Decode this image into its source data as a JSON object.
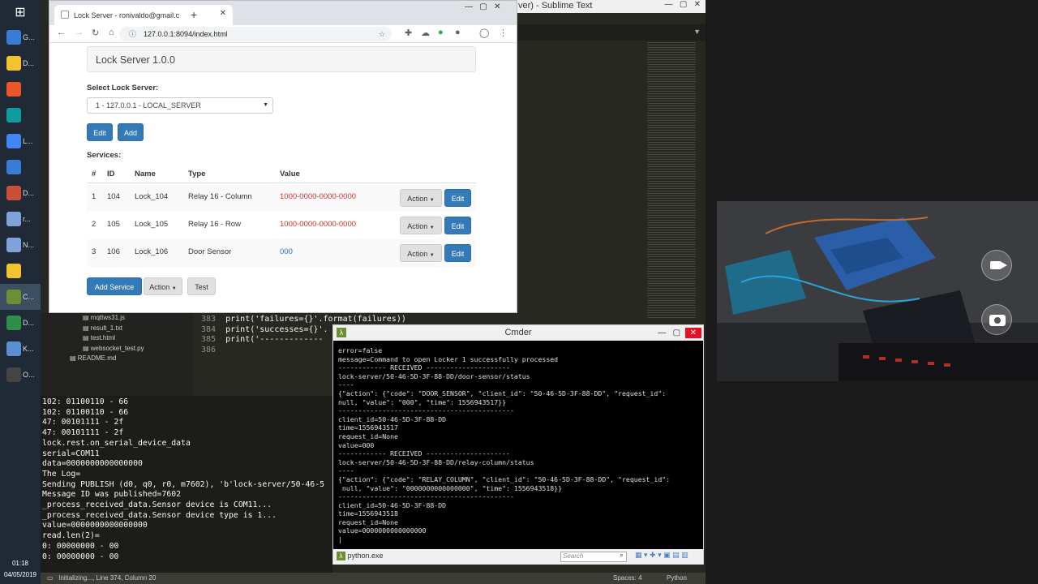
{
  "taskbar": {
    "items": [
      {
        "label": "G..."
      },
      {
        "label": "D..."
      },
      {
        "label": ""
      },
      {
        "label": ""
      },
      {
        "label": "L..."
      },
      {
        "label": ""
      },
      {
        "label": "D..."
      },
      {
        "label": "r..."
      },
      {
        "label": "N..."
      },
      {
        "label": ""
      },
      {
        "label": "C..."
      },
      {
        "label": "D..."
      },
      {
        "label": "K..."
      },
      {
        "label": "O..."
      }
    ],
    "time": "01:18",
    "date": "04/05/2019"
  },
  "sublime": {
    "title": "ver) - Sublime Text",
    "code_lines": [
      {
        "num": "383",
        "text": "print('failures={}'.format(failures))"
      },
      {
        "num": "384",
        "text": "print('successes={}'."
      },
      {
        "num": "385",
        "text": "print('-------------"
      },
      {
        "num": "386",
        "text": ""
      }
    ],
    "sidebar_files": [
      "mqttws31.js",
      "result_1.txt",
      "test.html",
      "websocket_test.py",
      "README.md"
    ],
    "console_lines": [
      "102: 01100110 - 66",
      "102: 01100110 - 66",
      "47: 00101111 - 2f",
      "47: 00101111 - 2f",
      "lock.rest.on_serial_device_data",
      "serial=COM11",
      "data=0000000000000000",
      "The Log=",
      "Sending PUBLISH (d0, q0, r0, m7602), 'b'lock-server/50-46-5",
      "Message ID was published=7602",
      "_process_received_data.Sensor device is COM11...",
      "_process_received_data.Sensor device type is 1...",
      "value=0000000000000000",
      "read.len(2)=",
      "0: 00000000 - 00",
      "0: 00000000 - 00"
    ],
    "status_left": "Initializing..., Line 374, Column 20",
    "status_spaces": "Spaces: 4",
    "status_lang": "Python"
  },
  "browser": {
    "tab_title": "Lock Server - ronivaldo@gmail.c",
    "url": "127.0.0.1:8094/index.html",
    "app_title": "Lock Server 1.0.0",
    "select_label": "Select Lock Server:",
    "select_value": "1 - 127.0.0.1 - LOCAL_SERVER",
    "edit_label": "Edit",
    "add_label": "Add",
    "services_label": "Services:",
    "columns": [
      "#",
      "ID",
      "Name",
      "Type",
      "Value"
    ],
    "rows": [
      {
        "n": "1",
        "id": "104",
        "name": "Lock_104",
        "type": "Relay 16 - Column",
        "value": "1000-0000-0000-0000"
      },
      {
        "n": "2",
        "id": "105",
        "name": "Lock_105",
        "type": "Relay 16 - Row",
        "value": "1000-0000-0000-0000"
      },
      {
        "n": "3",
        "id": "106",
        "name": "Lock_106",
        "type": "Door Sensor",
        "value": "000"
      }
    ],
    "action_label": "Action",
    "row_edit_label": "Edit",
    "add_service_label": "Add Service",
    "test_label": "Test"
  },
  "cmder": {
    "title": "Cmder",
    "lines": [
      "error=false",
      "message=Command to open Locker 1 successfully processed",
      "------------ RECEIVED ---------------------",
      "lock-server/50-46-5D-3F-88-DD/door-sensor/status",
      "----",
      "{\"action\": {\"code\": \"DOOR_SENSOR\", \"client_id\": \"50-46-5D-3F-88-DD\", \"request_id\":",
      "null, \"value\": \"000\", \"time\": 1556943517}}",
      "--------------------------------------------",
      "client_id=50-46-5D-3F-88-DD",
      "time=1556943517",
      "request_id=None",
      "value=000",
      "------------ RECEIVED ---------------------",
      "lock-server/50-46-5D-3F-88-DD/relay-column/status",
      "----",
      "{\"action\": {\"code\": \"RELAY_COLUMN\", \"client_id\": \"50-46-5D-3F-88-DD\", \"request_id\":",
      " null, \"value\": \"0000000000000000\", \"time\": 1556943518}}",
      "--------------------------------------------",
      "client_id=50-46-5D-3F-88-DD",
      "time=1556943518",
      "request_id=None",
      "value=0000000000000000",
      "|"
    ],
    "tab_label": "python.exe",
    "search_placeholder": "Search"
  }
}
